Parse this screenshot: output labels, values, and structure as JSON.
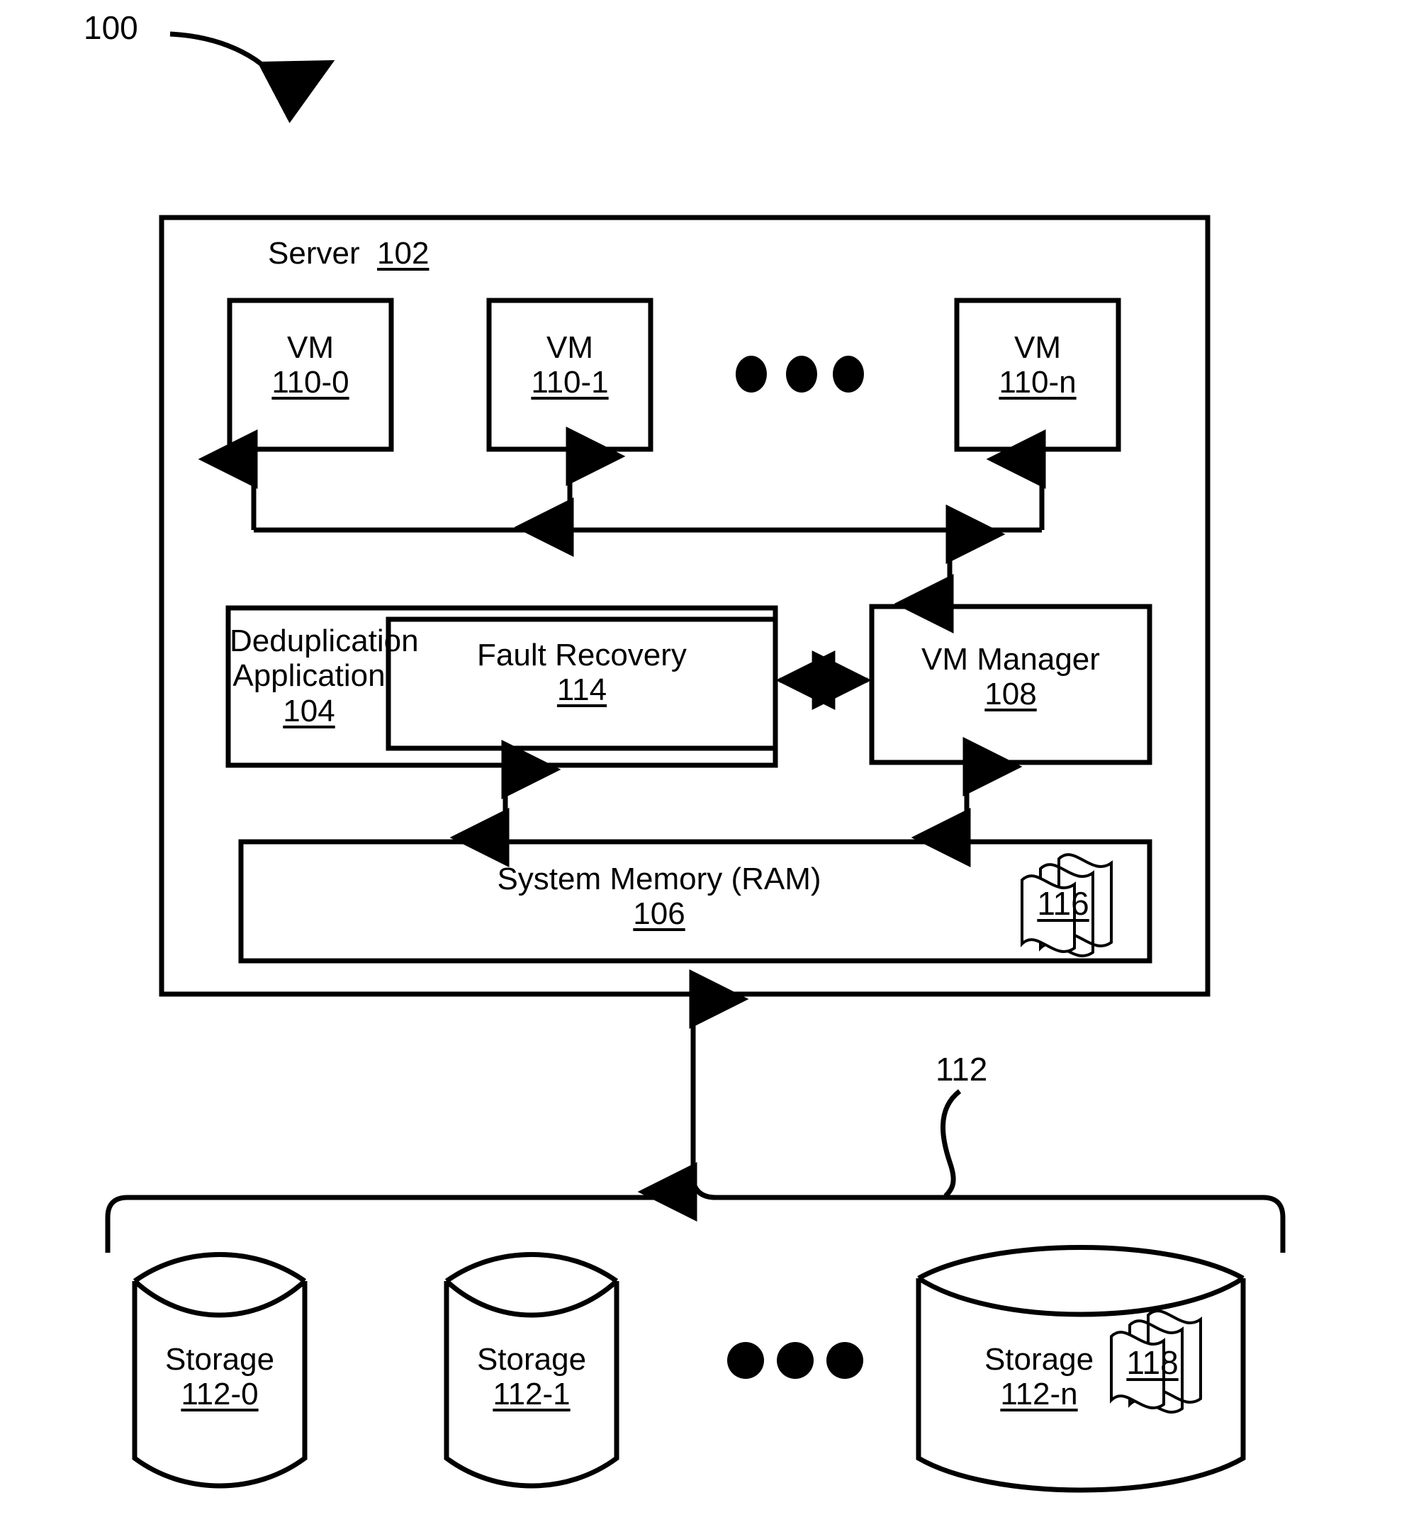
{
  "figure": {
    "number": "100",
    "type": "patent-block-diagram"
  },
  "server": {
    "title": "Server",
    "ref": "102"
  },
  "vms": [
    {
      "name": "VM",
      "ref": "110-0"
    },
    {
      "name": "VM",
      "ref": "110-1"
    },
    {
      "name": "VM",
      "ref": "110-n"
    }
  ],
  "vm_ellipsis": "•••",
  "dedup": {
    "line1": "Deduplication",
    "line2": "Application",
    "ref": "104"
  },
  "fault_recovery": {
    "title": "Fault Recovery",
    "ref": "114"
  },
  "vm_manager": {
    "title": "VM Manager",
    "ref": "108"
  },
  "system_memory": {
    "title": "System Memory (RAM)",
    "ref": "106",
    "data_icon_ref": "116"
  },
  "storage_group": {
    "ref": "112",
    "items": [
      {
        "name": "Storage",
        "ref": "112-0"
      },
      {
        "name": "Storage",
        "ref": "112-1"
      },
      {
        "name": "Storage",
        "ref": "112-n",
        "data_icon_ref": "118"
      }
    ],
    "ellipsis": "•••"
  },
  "colors": {
    "ink": "#000000",
    "background": "#ffffff"
  }
}
